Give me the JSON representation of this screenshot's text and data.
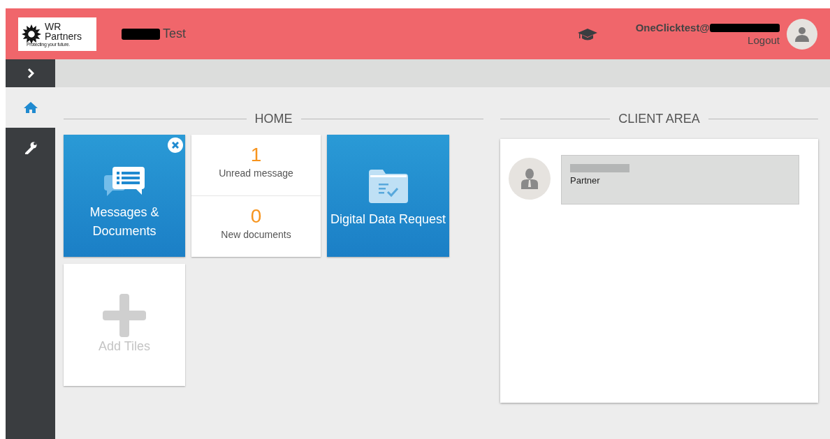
{
  "header": {
    "logo": {
      "line1": "WR",
      "line2": "Partners",
      "tagline": "Protecting your future."
    },
    "title": "Test",
    "title_redacted": true,
    "user_email": "OneClicktest@",
    "email_redacted": true,
    "logout": "Logout"
  },
  "sidebar": {
    "collapsed": true,
    "items": [
      {
        "selected": true
      },
      {
        "selected": false
      }
    ]
  },
  "sections": {
    "home": {
      "heading": "HOME"
    },
    "client_area": {
      "heading": "CLIENT AREA"
    }
  },
  "tiles": [
    {
      "kind": "messages",
      "label": "Messages & Documents",
      "stats": [
        {
          "count": "1",
          "label": "Unread message"
        },
        {
          "count": "0",
          "label": "New documents"
        }
      ]
    },
    {
      "kind": "link",
      "label": "Digital Data Request"
    },
    {
      "kind": "add",
      "label": "Add Tiles"
    }
  ],
  "client_card": {
    "role": "Partner",
    "name_redacted": true
  }
}
